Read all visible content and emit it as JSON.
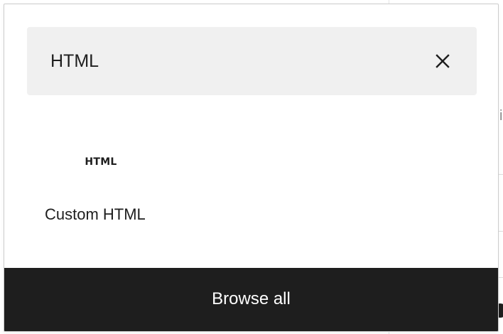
{
  "search": {
    "value": "HTML",
    "clear_icon": "close-icon"
  },
  "results": [
    {
      "icon_text": "HTML",
      "label": "Custom HTML"
    }
  ],
  "footer": {
    "browse_all_label": "Browse all"
  },
  "backdrop": {
    "fragment_text": "i"
  },
  "colors": {
    "accent_dark": "#1e1e1e",
    "search_bg": "#f0f0f0",
    "text": "#1e1e1e"
  }
}
